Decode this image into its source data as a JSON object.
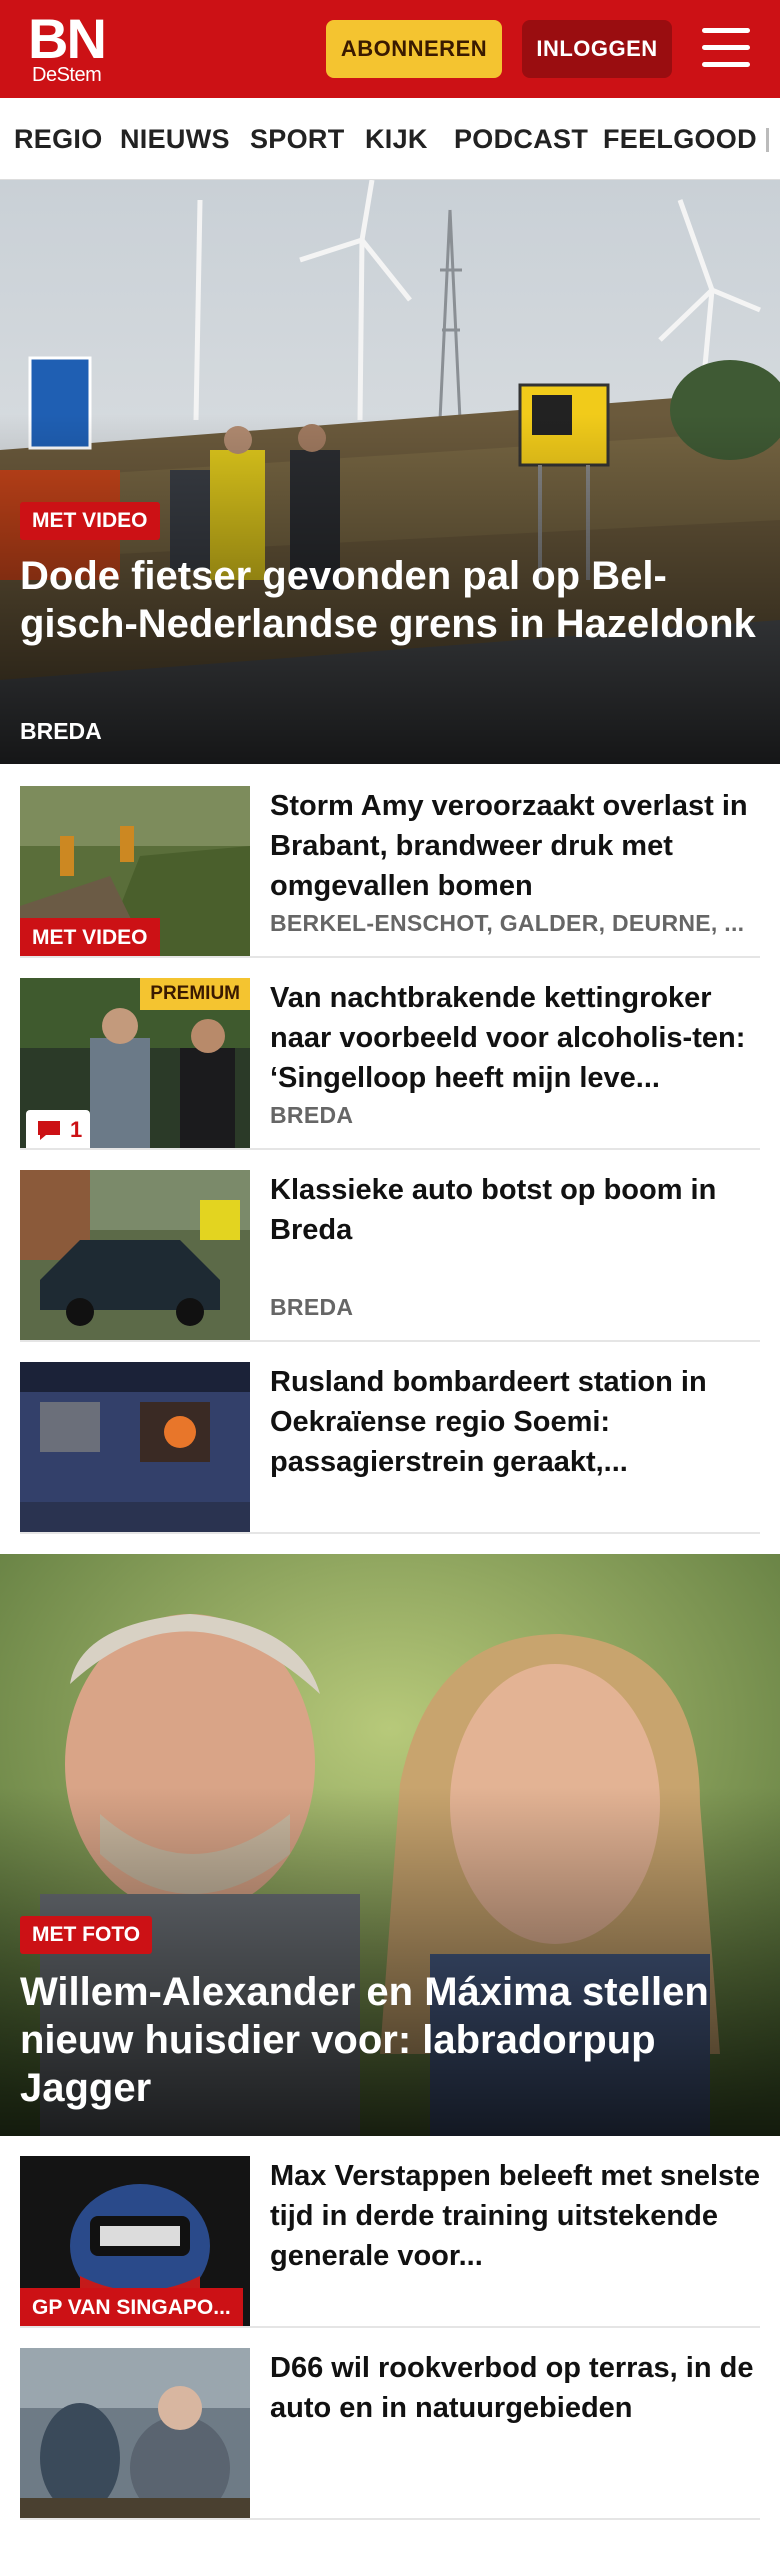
{
  "header": {
    "logo_main": "BN",
    "logo_sub": "DeStem",
    "subscribe_label": "ABONNEREN",
    "login_label": "INLOGGEN",
    "brand_color": "#cc1115",
    "accent_color": "#f4c430"
  },
  "nav": {
    "items": [
      "REGIO",
      "NIEUWS",
      "SPORT",
      "KIJK",
      "PODCAST",
      "FEELGOOD"
    ]
  },
  "hero1": {
    "badge": "MET VIDEO",
    "title": "Dode fietser gevonden pal op Bel-gisch-Nederlandse grens in Hazeldonk",
    "location": "BREDA"
  },
  "list1": [
    {
      "title": "Storm Amy veroorzaakt overlast in Brabant, brandweer druk met omgevallen bomen",
      "location": "BERKEL-ENSCHOT, GALDER, DEURNE, ...",
      "badge": "MET VIDEO"
    },
    {
      "title": "Van nachtbrakende kettingroker naar voorbeeld voor alcoholis-ten: ‘Singelloop heeft mijn leve...",
      "location": "BREDA",
      "premium": "PREMIUM",
      "comments": "1"
    },
    {
      "title": "Klassieke auto botst op boom in Breda",
      "location": "BREDA"
    },
    {
      "title": "Rusland bombardeert station in Oekraïense regio Soemi: passagierstrein geraakt,..."
    }
  ],
  "hero2": {
    "badge": "MET FOTO",
    "title": "Willem-Alexander en Máxima stellen nieuw huisdier voor: labradorpup Jagger"
  },
  "list2": [
    {
      "title": "Max Verstappen beleeft met snelste tijd in derde training uitstekende generale voor...",
      "badge": "GP VAN SINGAPO..."
    },
    {
      "title": "D66 wil rookverbod op terras, in de auto en in natuurgebieden"
    }
  ]
}
